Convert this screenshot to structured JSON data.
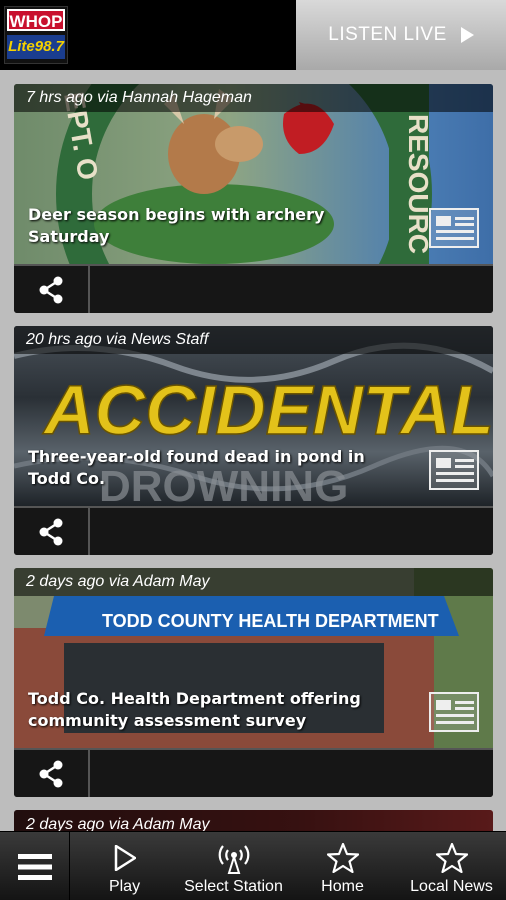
{
  "header": {
    "logo": {
      "top_text": "WHOP",
      "bottom_text": "Lite98.7"
    },
    "listen_live_label": "LISTEN LIVE"
  },
  "feed": {
    "cards": [
      {
        "meta": "7 hrs ago via Hannah Hageman",
        "title": "Deer season begins with archery Saturday",
        "image": "deer-logo"
      },
      {
        "meta": "20 hrs ago via News Staff",
        "title": "Three-year-old found dead in pond in Todd Co.",
        "image": "accidental-drowning"
      },
      {
        "meta": "2 days ago via Adam May",
        "title": "Todd Co. Health Department offering community assessment survey",
        "image": "todd-county-health-department"
      }
    ],
    "partial_card": {
      "meta": "2 days ago via Adam May"
    },
    "image_text": {
      "accidental": "ACCIDENTAL",
      "drowning": "DROWNING",
      "awning": "TODD COUNTY HEALTH DEPARTMENT",
      "resource": "RESOURC",
      "dept": "EPT. O"
    }
  },
  "bottom_nav": {
    "items": [
      {
        "label": "Play",
        "icon": "play-icon"
      },
      {
        "label": "Select Station",
        "icon": "antenna-icon"
      },
      {
        "label": "Home",
        "icon": "star-icon"
      },
      {
        "label": "Local News",
        "icon": "star-icon"
      }
    ]
  },
  "colors": {
    "accent_red": "#c8102e",
    "nav_bg": "#1e1e1e",
    "page_bg": "#bdbdbd"
  }
}
